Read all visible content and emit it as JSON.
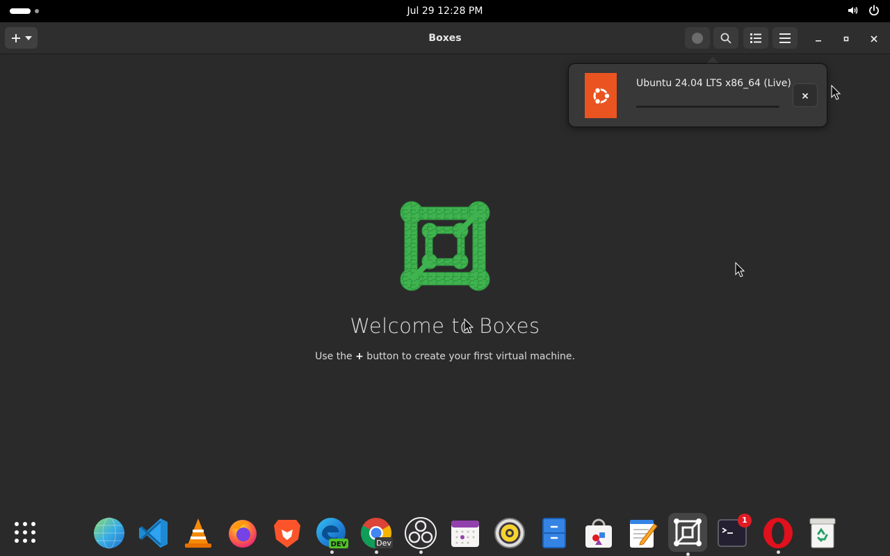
{
  "topbar": {
    "clock": "Jul 29  12:28 PM",
    "icons": [
      "activities-indicator",
      "volume-icon",
      "power-icon"
    ]
  },
  "headerbar": {
    "title": "Boxes",
    "new_button_icons": [
      "plus-icon",
      "chevron-down-icon"
    ],
    "buttons": [
      "downloads-indicator-icon",
      "search-icon",
      "view-list-icon",
      "main-menu-icon"
    ],
    "window_controls": [
      "minimize-icon",
      "maximize-icon",
      "close-icon"
    ]
  },
  "popover": {
    "os_name": "Ubuntu 24.04 LTS x86_64 (Live)",
    "progress": 0.0,
    "cancel_icon": "close-icon",
    "brand_color": "#e95420"
  },
  "welcome": {
    "title": "Welcome to Boxes",
    "subtitle_before": "Use the ",
    "subtitle_bold": "+",
    "subtitle_after": " button to create your first virtual machine."
  },
  "dock": {
    "items": [
      {
        "name": "show-apps",
        "icon": "app-grid-icon"
      },
      {
        "name": "web-browser",
        "icon": "globe-icon"
      },
      {
        "name": "vscode",
        "icon": "vscode-icon"
      },
      {
        "name": "vlc",
        "icon": "vlc-cone-icon"
      },
      {
        "name": "firefox",
        "icon": "firefox-icon"
      },
      {
        "name": "brave",
        "icon": "brave-lion-icon"
      },
      {
        "name": "edge-dev",
        "icon": "edge-dev-icon",
        "label": "DEV",
        "running": true
      },
      {
        "name": "chrome-dev",
        "icon": "chrome-dev-icon",
        "label": "Dev",
        "running": true
      },
      {
        "name": "obs",
        "icon": "obs-icon",
        "running": true
      },
      {
        "name": "calendar",
        "icon": "calendar-icon"
      },
      {
        "name": "rhythmbox",
        "icon": "speaker-icon"
      },
      {
        "name": "files",
        "icon": "file-cabinet-icon"
      },
      {
        "name": "software",
        "icon": "store-bag-icon"
      },
      {
        "name": "text-editor",
        "icon": "notepad-icon"
      },
      {
        "name": "boxes",
        "icon": "boxes-icon",
        "running": true,
        "active": true
      },
      {
        "name": "terminal",
        "icon": "terminal-icon",
        "badge": "1"
      },
      {
        "name": "opera",
        "icon": "opera-icon",
        "running": true
      },
      {
        "name": "trash",
        "icon": "trash-recycle-icon"
      }
    ]
  },
  "colors": {
    "accent": "#3584e4",
    "boxes_green": "#3fb34f",
    "badge": "#e01b24"
  }
}
